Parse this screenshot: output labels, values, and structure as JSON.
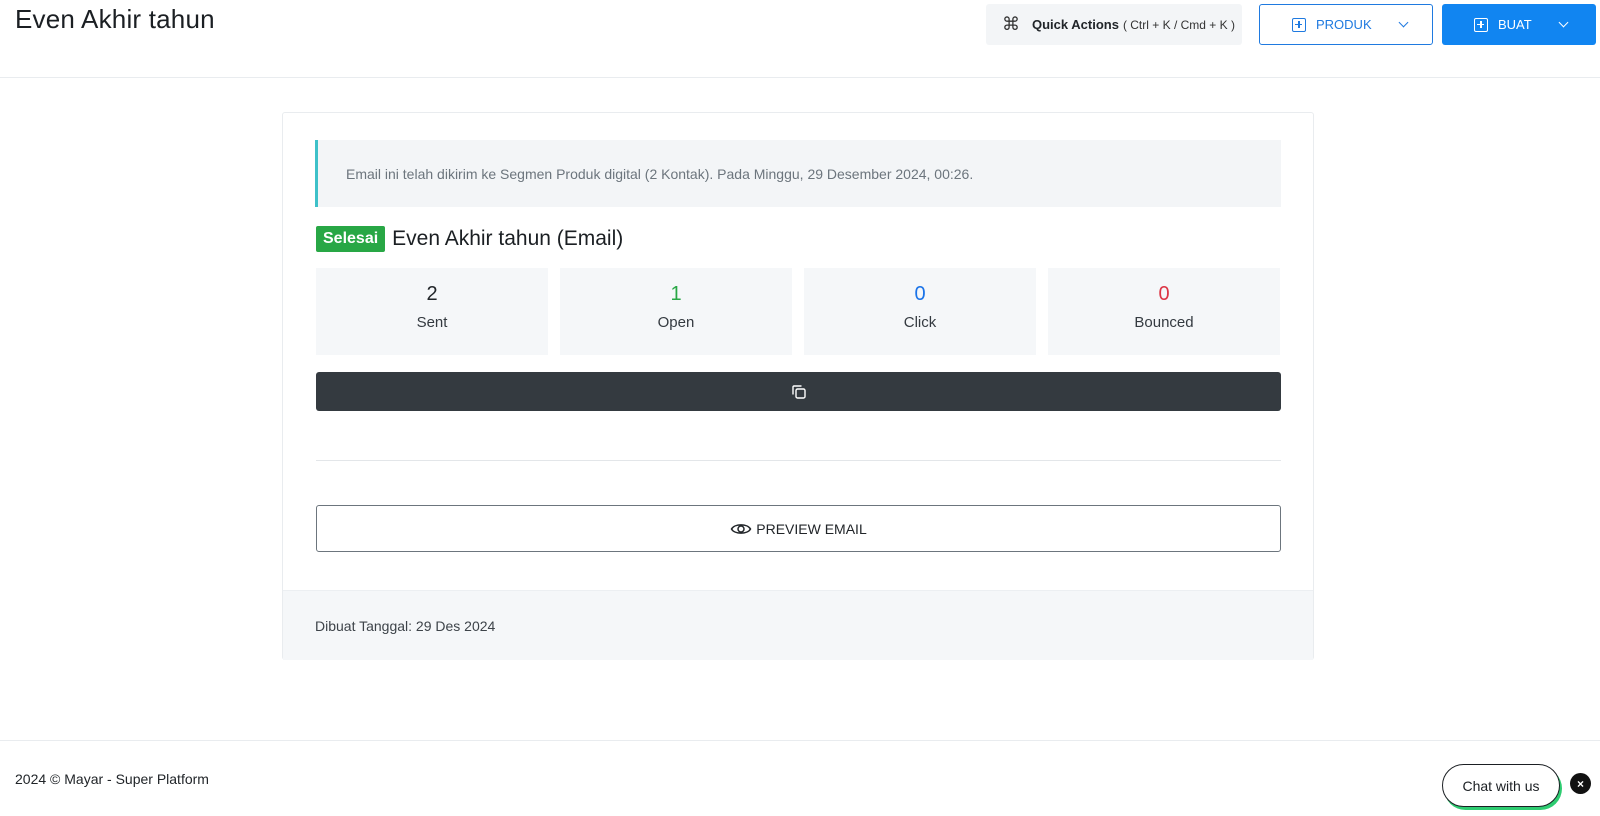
{
  "header": {
    "title": "Even Akhir tahun",
    "quick_actions_label": "Quick Actions",
    "quick_actions_keys": "( Ctrl + K / Cmd + K )",
    "produk_label": "PRODUK",
    "buat_label": "BUAT"
  },
  "card": {
    "alert_text": "Email ini telah dikirim ke Segmen Produk digital (2 Kontak). Pada Minggu, 29 Desember 2024, 00:26.",
    "status_badge": "Selesai",
    "campaign_title": "Even Akhir tahun (Email)",
    "stats": [
      {
        "value": "2",
        "label": "Sent"
      },
      {
        "value": "1",
        "label": "Open"
      },
      {
        "value": "0",
        "label": "Click"
      },
      {
        "value": "0",
        "label": "Bounced"
      }
    ],
    "preview_label": "PREVIEW EMAIL",
    "created_text": "Dibuat Tanggal: 29 Des 2024"
  },
  "footer": {
    "copyright": "2024 © Mayar - Super Platform",
    "chat_label": "Chat with us",
    "chat_close": "×"
  },
  "colors": {
    "primary": "#1185f1",
    "success": "#28a745",
    "danger": "#dc3545",
    "dark": "#343a40",
    "alert_accent": "#3ec1c9"
  },
  "icons": {
    "quick_actions": "command-icon",
    "produk": "plus-square-icon",
    "buat": "plus-square-icon",
    "copy_bar": "copy-icon",
    "preview": "eye-icon"
  }
}
